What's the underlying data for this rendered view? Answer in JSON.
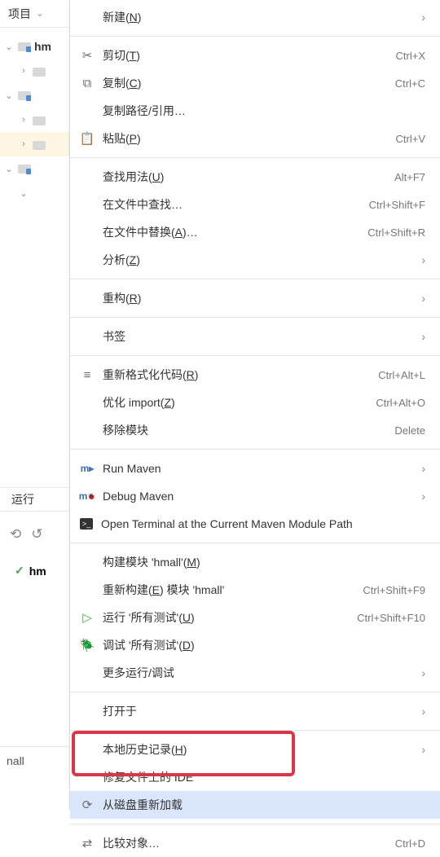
{
  "left": {
    "project_label": "项目",
    "tree": {
      "root": "hm",
      "run_label": "运行",
      "hm_bold": "hm",
      "bottom_tab": "nall"
    }
  },
  "menu": {
    "new": "新建(N)",
    "cut": "剪切(T)",
    "cut_short": "Ctrl+X",
    "copy": "复制(C)",
    "copy_short": "Ctrl+C",
    "copy_path": "复制路径/引用…",
    "paste": "粘贴(P)",
    "paste_short": "Ctrl+V",
    "find_usage": "查找用法(U)",
    "find_usage_short": "Alt+F7",
    "find_in_files": "在文件中查找…",
    "find_in_files_short": "Ctrl+Shift+F",
    "replace_in_files": "在文件中替换(A)…",
    "replace_in_files_short": "Ctrl+Shift+R",
    "analyze": "分析(Z)",
    "refactor": "重构(R)",
    "bookmarks": "书签",
    "reformat": "重新格式化代码(R)",
    "reformat_short": "Ctrl+Alt+L",
    "optimize_imports": "优化 import(Z)",
    "optimize_imports_short": "Ctrl+Alt+O",
    "remove_module": "移除模块",
    "remove_module_short": "Delete",
    "run_maven": "Run Maven",
    "debug_maven": "Debug Maven",
    "open_terminal": "Open Terminal at the Current Maven Module Path",
    "build_module": "构建模块 'hmall'(M)",
    "rebuild_module": "重新构建(E) 模块 'hmall'",
    "rebuild_module_short": "Ctrl+Shift+F9",
    "run_tests": "运行 '所有测试'(U)",
    "run_tests_short": "Ctrl+Shift+F10",
    "debug_tests": "调试 '所有测试'(D)",
    "more_run": "更多运行/调试",
    "open_in": "打开于",
    "local_history": "本地历史记录(H)",
    "repair_ide": "修复文件上的 IDE",
    "reload_disk": "从磁盘重新加载",
    "compare_with": "比较对象…",
    "compare_with_short": "Ctrl+D"
  }
}
